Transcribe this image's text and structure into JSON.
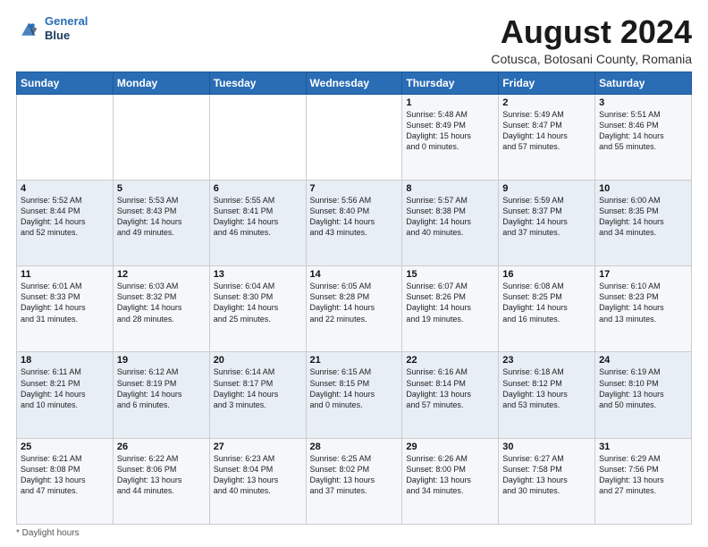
{
  "header": {
    "logo_line1": "General",
    "logo_line2": "Blue",
    "title": "August 2024",
    "subtitle": "Cotusca, Botosani County, Romania"
  },
  "days_of_week": [
    "Sunday",
    "Monday",
    "Tuesday",
    "Wednesday",
    "Thursday",
    "Friday",
    "Saturday"
  ],
  "weeks": [
    [
      {
        "day": "",
        "info": ""
      },
      {
        "day": "",
        "info": ""
      },
      {
        "day": "",
        "info": ""
      },
      {
        "day": "",
        "info": ""
      },
      {
        "day": "1",
        "info": "Sunrise: 5:48 AM\nSunset: 8:49 PM\nDaylight: 15 hours\nand 0 minutes."
      },
      {
        "day": "2",
        "info": "Sunrise: 5:49 AM\nSunset: 8:47 PM\nDaylight: 14 hours\nand 57 minutes."
      },
      {
        "day": "3",
        "info": "Sunrise: 5:51 AM\nSunset: 8:46 PM\nDaylight: 14 hours\nand 55 minutes."
      }
    ],
    [
      {
        "day": "4",
        "info": "Sunrise: 5:52 AM\nSunset: 8:44 PM\nDaylight: 14 hours\nand 52 minutes."
      },
      {
        "day": "5",
        "info": "Sunrise: 5:53 AM\nSunset: 8:43 PM\nDaylight: 14 hours\nand 49 minutes."
      },
      {
        "day": "6",
        "info": "Sunrise: 5:55 AM\nSunset: 8:41 PM\nDaylight: 14 hours\nand 46 minutes."
      },
      {
        "day": "7",
        "info": "Sunrise: 5:56 AM\nSunset: 8:40 PM\nDaylight: 14 hours\nand 43 minutes."
      },
      {
        "day": "8",
        "info": "Sunrise: 5:57 AM\nSunset: 8:38 PM\nDaylight: 14 hours\nand 40 minutes."
      },
      {
        "day": "9",
        "info": "Sunrise: 5:59 AM\nSunset: 8:37 PM\nDaylight: 14 hours\nand 37 minutes."
      },
      {
        "day": "10",
        "info": "Sunrise: 6:00 AM\nSunset: 8:35 PM\nDaylight: 14 hours\nand 34 minutes."
      }
    ],
    [
      {
        "day": "11",
        "info": "Sunrise: 6:01 AM\nSunset: 8:33 PM\nDaylight: 14 hours\nand 31 minutes."
      },
      {
        "day": "12",
        "info": "Sunrise: 6:03 AM\nSunset: 8:32 PM\nDaylight: 14 hours\nand 28 minutes."
      },
      {
        "day": "13",
        "info": "Sunrise: 6:04 AM\nSunset: 8:30 PM\nDaylight: 14 hours\nand 25 minutes."
      },
      {
        "day": "14",
        "info": "Sunrise: 6:05 AM\nSunset: 8:28 PM\nDaylight: 14 hours\nand 22 minutes."
      },
      {
        "day": "15",
        "info": "Sunrise: 6:07 AM\nSunset: 8:26 PM\nDaylight: 14 hours\nand 19 minutes."
      },
      {
        "day": "16",
        "info": "Sunrise: 6:08 AM\nSunset: 8:25 PM\nDaylight: 14 hours\nand 16 minutes."
      },
      {
        "day": "17",
        "info": "Sunrise: 6:10 AM\nSunset: 8:23 PM\nDaylight: 14 hours\nand 13 minutes."
      }
    ],
    [
      {
        "day": "18",
        "info": "Sunrise: 6:11 AM\nSunset: 8:21 PM\nDaylight: 14 hours\nand 10 minutes."
      },
      {
        "day": "19",
        "info": "Sunrise: 6:12 AM\nSunset: 8:19 PM\nDaylight: 14 hours\nand 6 minutes."
      },
      {
        "day": "20",
        "info": "Sunrise: 6:14 AM\nSunset: 8:17 PM\nDaylight: 14 hours\nand 3 minutes."
      },
      {
        "day": "21",
        "info": "Sunrise: 6:15 AM\nSunset: 8:15 PM\nDaylight: 14 hours\nand 0 minutes."
      },
      {
        "day": "22",
        "info": "Sunrise: 6:16 AM\nSunset: 8:14 PM\nDaylight: 13 hours\nand 57 minutes."
      },
      {
        "day": "23",
        "info": "Sunrise: 6:18 AM\nSunset: 8:12 PM\nDaylight: 13 hours\nand 53 minutes."
      },
      {
        "day": "24",
        "info": "Sunrise: 6:19 AM\nSunset: 8:10 PM\nDaylight: 13 hours\nand 50 minutes."
      }
    ],
    [
      {
        "day": "25",
        "info": "Sunrise: 6:21 AM\nSunset: 8:08 PM\nDaylight: 13 hours\nand 47 minutes."
      },
      {
        "day": "26",
        "info": "Sunrise: 6:22 AM\nSunset: 8:06 PM\nDaylight: 13 hours\nand 44 minutes."
      },
      {
        "day": "27",
        "info": "Sunrise: 6:23 AM\nSunset: 8:04 PM\nDaylight: 13 hours\nand 40 minutes."
      },
      {
        "day": "28",
        "info": "Sunrise: 6:25 AM\nSunset: 8:02 PM\nDaylight: 13 hours\nand 37 minutes."
      },
      {
        "day": "29",
        "info": "Sunrise: 6:26 AM\nSunset: 8:00 PM\nDaylight: 13 hours\nand 34 minutes."
      },
      {
        "day": "30",
        "info": "Sunrise: 6:27 AM\nSunset: 7:58 PM\nDaylight: 13 hours\nand 30 minutes."
      },
      {
        "day": "31",
        "info": "Sunrise: 6:29 AM\nSunset: 7:56 PM\nDaylight: 13 hours\nand 27 minutes."
      }
    ]
  ],
  "footer": {
    "note": "Daylight hours"
  }
}
